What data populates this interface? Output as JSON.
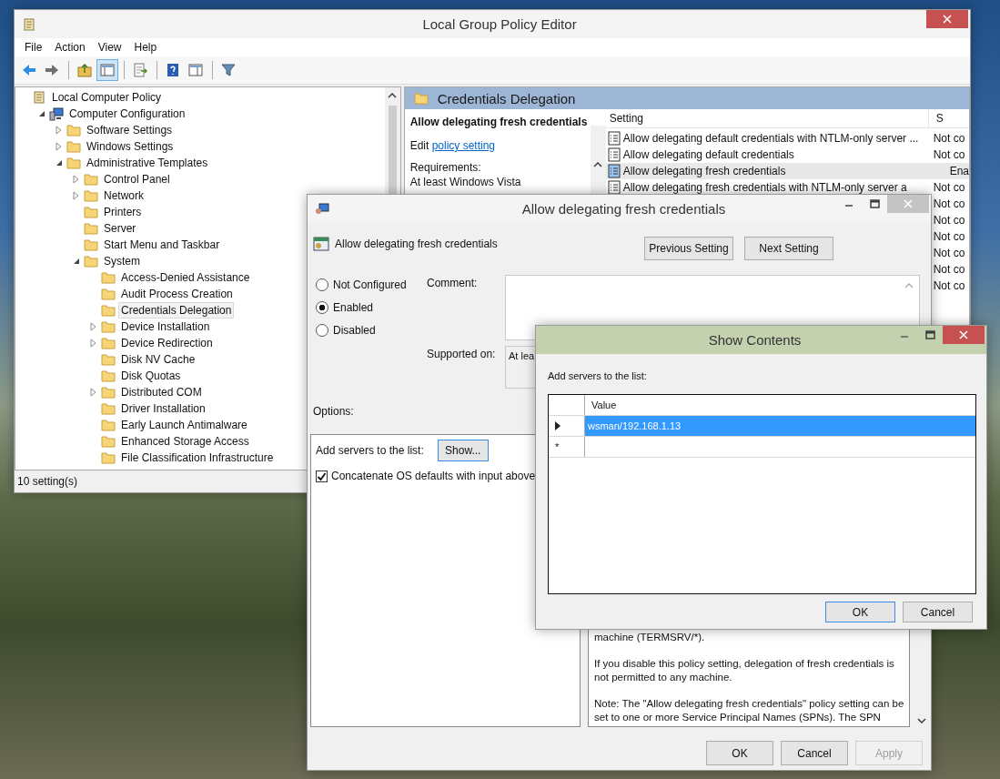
{
  "main_window": {
    "title": "Local Group Policy Editor",
    "menu": [
      "File",
      "Action",
      "View",
      "Help"
    ],
    "toolbar": [
      [
        {
          "kind": "back",
          "pressed": false
        },
        {
          "kind": "forward",
          "pressed": false
        }
      ],
      [
        {
          "kind": "up-folder",
          "pressed": false
        },
        {
          "kind": "tree-toggle",
          "pressed": true
        }
      ],
      [
        {
          "kind": "export",
          "pressed": false
        }
      ],
      [
        {
          "kind": "help",
          "pressed": false
        },
        {
          "kind": "pane",
          "pressed": false
        }
      ],
      [
        {
          "kind": "filter",
          "pressed": false
        }
      ]
    ],
    "tree": [
      {
        "label": "Local Computer Policy",
        "kind": "policy",
        "selected": false,
        "children": [
          {
            "label": "Computer Configuration",
            "kind": "computer",
            "expanded": true,
            "selected": false,
            "children": [
              {
                "label": "Software Settings",
                "kind": "folder",
                "expanded": false,
                "selected": false
              },
              {
                "label": "Windows Settings",
                "kind": "folder",
                "expanded": false,
                "selected": false
              },
              {
                "label": "Administrative Templates",
                "kind": "folder",
                "expanded": true,
                "selected": false,
                "children": [
                  {
                    "label": "Control Panel",
                    "kind": "folder",
                    "expanded": false,
                    "selected": false
                  },
                  {
                    "label": "Network",
                    "kind": "folder",
                    "expanded": false,
                    "selected": false
                  },
                  {
                    "label": "Printers",
                    "kind": "folder",
                    "selected": false
                  },
                  {
                    "label": "Server",
                    "kind": "folder",
                    "selected": false
                  },
                  {
                    "label": "Start Menu and Taskbar",
                    "kind": "folder",
                    "selected": false
                  },
                  {
                    "label": "System",
                    "kind": "folder",
                    "expanded": true,
                    "selected": false,
                    "children": [
                      {
                        "label": "Access-Denied Assistance",
                        "kind": "folder",
                        "selected": false
                      },
                      {
                        "label": "Audit Process Creation",
                        "kind": "folder",
                        "selected": false
                      },
                      {
                        "label": "Credentials Delegation",
                        "kind": "folder",
                        "selected": true
                      },
                      {
                        "label": "Device Installation",
                        "kind": "folder",
                        "expanded": false,
                        "selected": false
                      },
                      {
                        "label": "Device Redirection",
                        "kind": "folder",
                        "expanded": false,
                        "selected": false
                      },
                      {
                        "label": "Disk NV Cache",
                        "kind": "folder",
                        "selected": false
                      },
                      {
                        "label": "Disk Quotas",
                        "kind": "folder",
                        "selected": false
                      },
                      {
                        "label": "Distributed COM",
                        "kind": "folder",
                        "expanded": false,
                        "selected": false
                      },
                      {
                        "label": "Driver Installation",
                        "kind": "folder",
                        "selected": false
                      },
                      {
                        "label": "Early Launch Antimalware",
                        "kind": "folder",
                        "selected": false
                      },
                      {
                        "label": "Enhanced Storage Access",
                        "kind": "folder",
                        "selected": false
                      },
                      {
                        "label": "File Classification Infrastructure",
                        "kind": "folder",
                        "selected": false
                      }
                    ]
                  }
                ]
              }
            ]
          }
        ]
      }
    ],
    "folder_title": "Credentials Delegation",
    "description": {
      "title": "Allow delegating fresh credentials",
      "edit_prefix": "Edit",
      "edit_link": "policy setting",
      "requirements_label": "Requirements:",
      "requirements": "At least Windows Vista"
    },
    "settings": {
      "columns": [
        "Setting",
        "S"
      ],
      "rows": [
        {
          "name": "Allow delegating default credentials with NTLM-only server ...",
          "state": "Not co",
          "selected": false
        },
        {
          "name": "Allow delegating default credentials",
          "state": "Not co",
          "selected": false
        },
        {
          "name": "Allow delegating fresh credentials",
          "state": "Ena",
          "selected": true
        },
        {
          "name": "Allow delegating fresh credentials with NTLM-only server a",
          "state": "Not co",
          "selected": false
        },
        {
          "state": "Not co",
          "selected": false
        },
        {
          "state": "Not co",
          "selected": false
        },
        {
          "state": "Not co",
          "selected": false
        },
        {
          "state": "Not co",
          "selected": false
        },
        {
          "state": "Not co",
          "selected": false
        },
        {
          "state": "Not co",
          "selected": false
        }
      ]
    },
    "status_bar": "10 setting(s)"
  },
  "policy_dialog": {
    "title": "Allow delegating fresh credentials",
    "setting_name": "Allow delegating fresh credentials",
    "nav_buttons": [
      "Previous Setting",
      "Next Setting"
    ],
    "radios": [
      {
        "label": "Not Configured",
        "selected": false
      },
      {
        "label": "Enabled",
        "selected": true
      },
      {
        "label": "Disabled",
        "selected": false
      }
    ],
    "comment_label": "Comment:",
    "supported_label": "Supported on:",
    "supported_value": "At lea",
    "options_label": "Options:",
    "options": {
      "add_label": "Add servers to the list:",
      "show_button": {
        "label": "Show...",
        "focused": true
      },
      "checkbox": {
        "label": "Concatenate OS defaults with input above",
        "checked": true
      }
    },
    "help_paragraphs": [
      "machine (TERMSRV/*).",
      "If you disable this policy setting, delegation of fresh credentials is not permitted to any machine.",
      "Note: The \"Allow delegating fresh credentials\" policy setting can be set to one or more Service Principal Names (SPNs). The SPN"
    ],
    "buttons": [
      {
        "label": "OK",
        "disabled": false
      },
      {
        "label": "Cancel",
        "disabled": false
      },
      {
        "label": "Apply",
        "disabled": true
      }
    ]
  },
  "show_contents": {
    "title": "Show Contents",
    "label": "Add servers to the list:",
    "column": "Value",
    "rows": [
      {
        "kind": "current",
        "value": "wsman/192.168.1.13",
        "selected": true
      },
      {
        "kind": "new",
        "marker": "*",
        "selected": false
      }
    ],
    "buttons": [
      {
        "label": "OK",
        "focused": true
      },
      {
        "label": "Cancel",
        "focused": false
      }
    ]
  }
}
